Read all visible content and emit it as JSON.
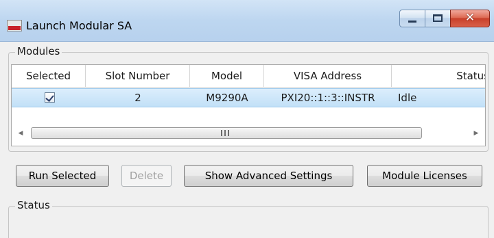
{
  "window": {
    "title": "Launch Modular SA",
    "caption": {
      "minimize": "minimize",
      "maximize": "maximize",
      "close": "✕"
    }
  },
  "modules": {
    "group_label": "Modules",
    "columns": [
      "Selected",
      "Slot Number",
      "Model",
      "VISA Address",
      "Status"
    ],
    "rows": [
      {
        "selected": true,
        "slot": "2",
        "model": "M9290A",
        "visa": "PXI20::1::3::INSTR",
        "status": "Idle"
      }
    ],
    "scrollbar": {
      "left_arrow": "◀",
      "right_arrow": "▶"
    }
  },
  "buttons": {
    "run_selected": "Run Selected",
    "delete": "Delete",
    "show_advanced": "Show Advanced Settings",
    "module_licenses": "Module Licenses"
  },
  "status": {
    "group_label": "Status"
  },
  "colors": {
    "selection_row": "#c2e0f7",
    "close_button": "#c8402a",
    "icon_accent": "#c8222a"
  },
  "icons": {
    "app": "app-icon",
    "minimize": "minimize-icon",
    "maximize": "maximize-icon",
    "close": "close-icon",
    "checkbox": "checkbox-checked-icon"
  }
}
